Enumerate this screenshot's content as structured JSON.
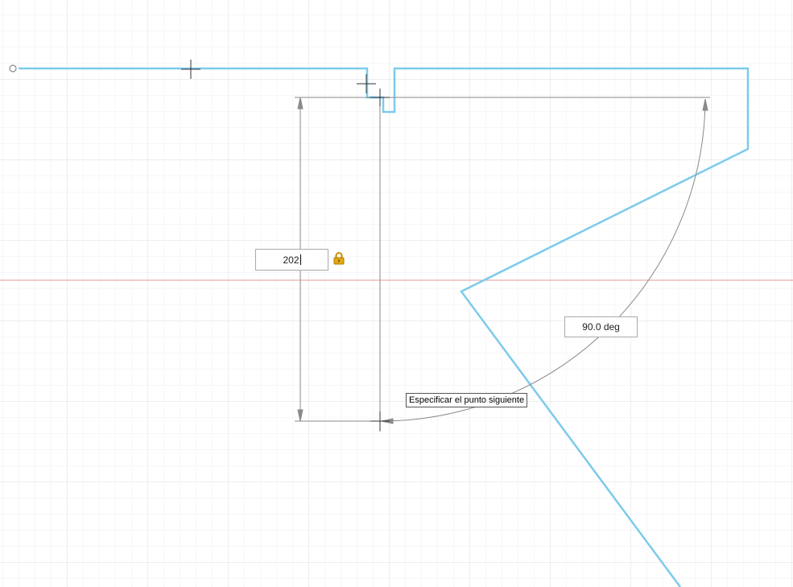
{
  "dimensions": {
    "length_value": "202",
    "length_locked": true,
    "angle_value": "90.0 deg"
  },
  "tooltip": {
    "text": "Especificar el punto siguiente"
  },
  "colors": {
    "sketch_line": "#7ccbeb",
    "dimension_line": "#8a8a8a",
    "x_axis": "#e39b9b",
    "grid_minor": "#eeeeee",
    "grid_major": "#dedede",
    "lock": "#e3a712"
  },
  "icons": [
    "lock-icon",
    "crosshair-cursor-icon",
    "start-point-icon"
  ]
}
